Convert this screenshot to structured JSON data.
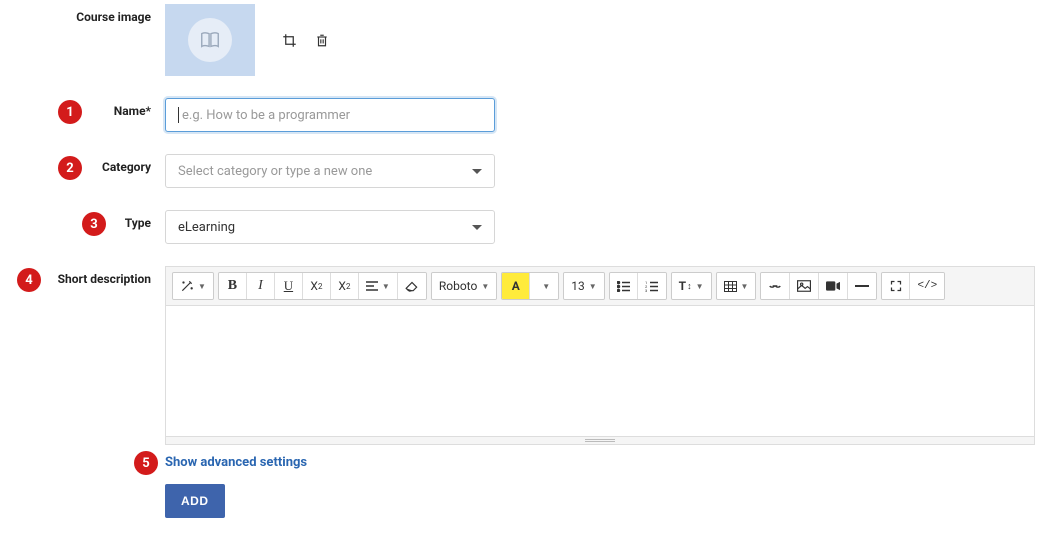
{
  "labels": {
    "course_image": "Course image",
    "name": "Name*",
    "category": "Category",
    "type": "Type",
    "short_description": "Short description"
  },
  "fields": {
    "name": {
      "value": "",
      "placeholder": "e.g. How to be a programmer"
    },
    "category": {
      "value": "",
      "placeholder": "Select category or type a new one"
    },
    "type": {
      "value": "eLearning"
    }
  },
  "toolbar": {
    "magic": "magic",
    "bold": "B",
    "italic": "I",
    "underline": "U",
    "superscript_base": "X",
    "subscript_base": "X",
    "align": "align",
    "eraser": "eraser",
    "font": "Roboto",
    "color": "A",
    "size": "13",
    "ul": "ul",
    "ol": "ol",
    "lineheight": "T",
    "table": "table",
    "link": "link",
    "image": "image",
    "video": "video",
    "hr": "hr",
    "fullscreen": "fullscreen",
    "code": "</>"
  },
  "actions": {
    "show_advanced": "Show advanced settings",
    "add": "ADD"
  },
  "markers": [
    "1",
    "2",
    "3",
    "4",
    "5"
  ]
}
